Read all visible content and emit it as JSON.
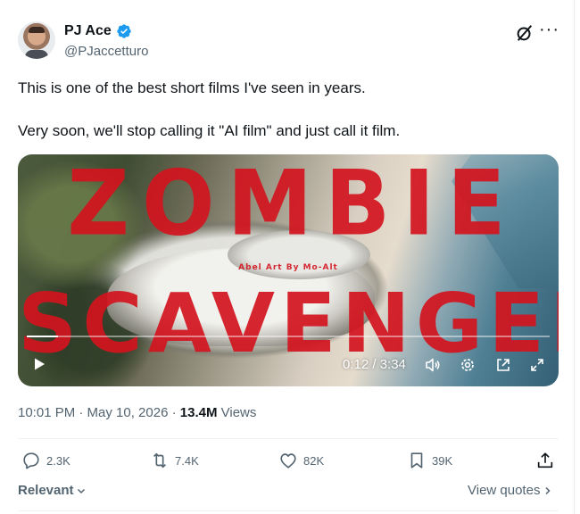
{
  "author": {
    "display_name": "PJ Ace",
    "handle": "@PJaccetturo",
    "verified": true
  },
  "tweet": {
    "paragraphs": [
      "This is one of the best short films I've seen in years.",
      "Very soon, we'll stop calling it \"AI film\" and just call it film."
    ]
  },
  "video": {
    "title_line1": "ZOMBIE",
    "title_line2": "SCAVENGER",
    "subtitle": "Abel Art By Mo-Alt",
    "time": "0:12 / 3:34",
    "progress": 0.06
  },
  "meta": {
    "timestamp": "10:01 PM · May 10, 2026 ·",
    "views_count": "13.4M",
    "views_label": "Views"
  },
  "actions": {
    "replies": "2.3K",
    "reposts": "7.4K",
    "likes": "82K",
    "bookmarks": "39K"
  },
  "footer": {
    "relevant_label": "Relevant",
    "view_quotes_label": "View quotes"
  },
  "colors": {
    "accent": "#1d9bf0",
    "muted": "#536471",
    "title_red": "#d2141e"
  },
  "icons": [
    "verified-badge-icon",
    "grok-icon",
    "more-icon",
    "play-icon",
    "volume-icon",
    "settings-icon",
    "popout-icon",
    "fullscreen-icon",
    "reply-icon",
    "repost-icon",
    "like-icon",
    "bookmark-icon",
    "share-icon",
    "chevron-down-icon",
    "chevron-right-icon"
  ]
}
